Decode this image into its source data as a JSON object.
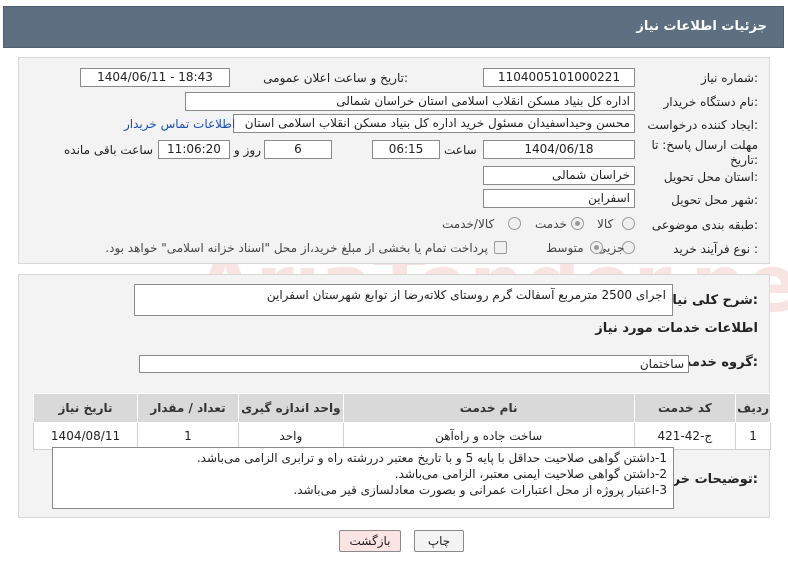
{
  "header": {
    "title": "جزئیات اطلاعات نیاز"
  },
  "fields": {
    "need_number": {
      "label": "شماره نیاز:",
      "value": "1104005101000221"
    },
    "announce_datetime": {
      "label": "تاریخ و ساعت اعلان عمومی:",
      "value": "1404/06/11 - 18:43"
    },
    "buyer_org": {
      "label": "نام دستگاه خریدار:",
      "value": "اداره کل بنیاد مسکن انقلاب اسلامی استان خراسان شمالی"
    },
    "requester": {
      "label": "ایجاد کننده درخواست:",
      "value": "محسن وحیداسفیدان مسئول خرید اداره کل بنیاد مسکن انقلاب اسلامی استان"
    },
    "contact_link": "اطلاعات تماس خریدار",
    "deadline": {
      "label": "مهلت ارسال پاسخ: تا تاریخ:",
      "date": "1404/06/18",
      "time_label": "ساعت",
      "time": "06:15",
      "days": "6",
      "days_label": "روز و",
      "remaining": "11:06:20",
      "remaining_label": "ساعت باقی مانده"
    },
    "province": {
      "label": "استان محل تحویل:",
      "value": "خراسان شمالی"
    },
    "city": {
      "label": "شهر محل تحویل:",
      "value": "اسفراین"
    },
    "category": {
      "label": "طبقه بندی موضوعی:",
      "options": [
        "کالا",
        "خدمت",
        "کالا/خدمت"
      ],
      "selected": "خدمت"
    },
    "process": {
      "label": "نوع فرآیند خرید :",
      "options": [
        "جزیی",
        "متوسط"
      ],
      "selected": "متوسط",
      "payment_note": "پرداخت تمام یا بخشی از مبلغ خرید،از محل \"اسناد خزانه اسلامی\" خواهد بود."
    }
  },
  "description": {
    "label": "شرح کلی نیاز:",
    "value": "اجرای 2500 مترمربع آسفالت گرم روستای کلاته‌رضا از توابع شهرستان اسفراین"
  },
  "services": {
    "section_title": "اطلاعات خدمات مورد نیاز",
    "group_label": "گروه خدمت:",
    "group_value": "ساختمان",
    "columns": [
      "ردیف",
      "کد خدمت",
      "نام خدمت",
      "واحد اندازه گیری",
      "تعداد / مقدار",
      "تاریخ نیاز"
    ],
    "rows": [
      [
        "1",
        "ج-42-421",
        "ساخت جاده و راه‌آهن",
        "واحد",
        "1",
        "1404/08/11"
      ]
    ]
  },
  "buyer_notes": {
    "label": "توضیحات خریدار:",
    "lines": [
      "1-داشتن گواهی صلاحیت حداقل با پایه 5 و با تاریخ معتبر دررشته راه و ترابری الزامی می‌باشد.",
      "2-داشتن گواهی صلاحیت ایمنی معتبر، الزامی می‌باشد.",
      "3-اعتبار پروژه از محل اعتبارات عمرانی و بصورت معادلسازی قیر می‌باشد."
    ]
  },
  "buttons": {
    "print": "چاپ",
    "back": "بازگشت"
  },
  "watermark": "AriaTender.net"
}
